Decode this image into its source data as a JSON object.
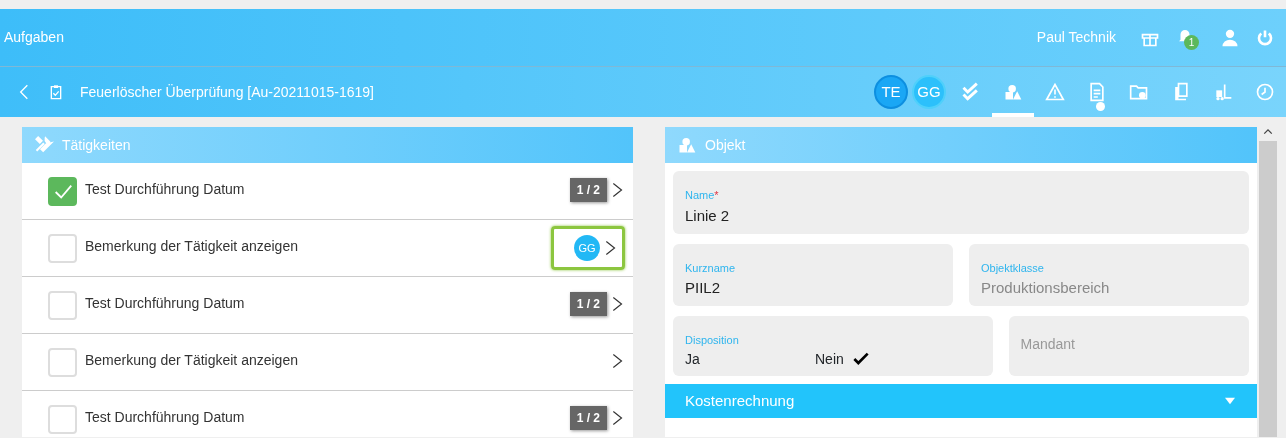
{
  "header": {
    "title": "Aufgaben",
    "user": "Paul Technik",
    "notification_count": "1"
  },
  "toolbar": {
    "title": "Feuerlöscher Überprüfung [Au-20211015-1619]",
    "avatars": [
      {
        "initials": "TE",
        "selected": true
      },
      {
        "initials": "GG",
        "selected": false
      }
    ],
    "tabs": [
      {
        "kind": "checks",
        "selected": false,
        "dot": false
      },
      {
        "kind": "objects",
        "selected": true,
        "dot": false
      },
      {
        "kind": "warning",
        "selected": false,
        "dot": false
      },
      {
        "kind": "document",
        "selected": false,
        "dot": true
      },
      {
        "kind": "folder",
        "selected": false,
        "dot": false
      },
      {
        "kind": "copies",
        "selected": false,
        "dot": false
      },
      {
        "kind": "forklift",
        "selected": false,
        "dot": false
      },
      {
        "kind": "clock",
        "selected": false,
        "dot": false
      }
    ]
  },
  "activities": {
    "title": "Tätigkeiten",
    "items": [
      {
        "label": "Test Durchführung Datum",
        "checked": true,
        "badge": "1 / 2"
      },
      {
        "label": "Bemerkung der Tätigkeit anzeigen",
        "checked": false,
        "assignee": "GG",
        "highlighted": true
      },
      {
        "label": "Test Durchführung Datum",
        "checked": false,
        "badge": "1 / 2"
      },
      {
        "label": "Bemerkung der Tätigkeit anzeigen",
        "checked": false
      },
      {
        "label": "Test Durchführung Datum",
        "checked": false,
        "badge": "1 / 2"
      }
    ]
  },
  "object": {
    "title": "Objekt",
    "rows": [
      [
        {
          "kind": "text",
          "label": "Name",
          "required_mark": "*",
          "value": "Linie 2"
        }
      ],
      [
        {
          "kind": "text",
          "label": "Kurzname",
          "value": "PIIL2"
        },
        {
          "kind": "text",
          "label": "Objektklasse",
          "value": "Produktionsbereich",
          "disabled": true
        }
      ],
      [
        {
          "kind": "choice",
          "label": "Disposition",
          "options": [
            {
              "label": "Ja",
              "selected": false
            },
            {
              "label": "Nein",
              "selected": true
            }
          ]
        },
        {
          "kind": "text",
          "placeholder": "Mandant"
        }
      ]
    ],
    "sections": [
      {
        "title": "Kostenrechnung",
        "expanded": false
      }
    ]
  }
}
